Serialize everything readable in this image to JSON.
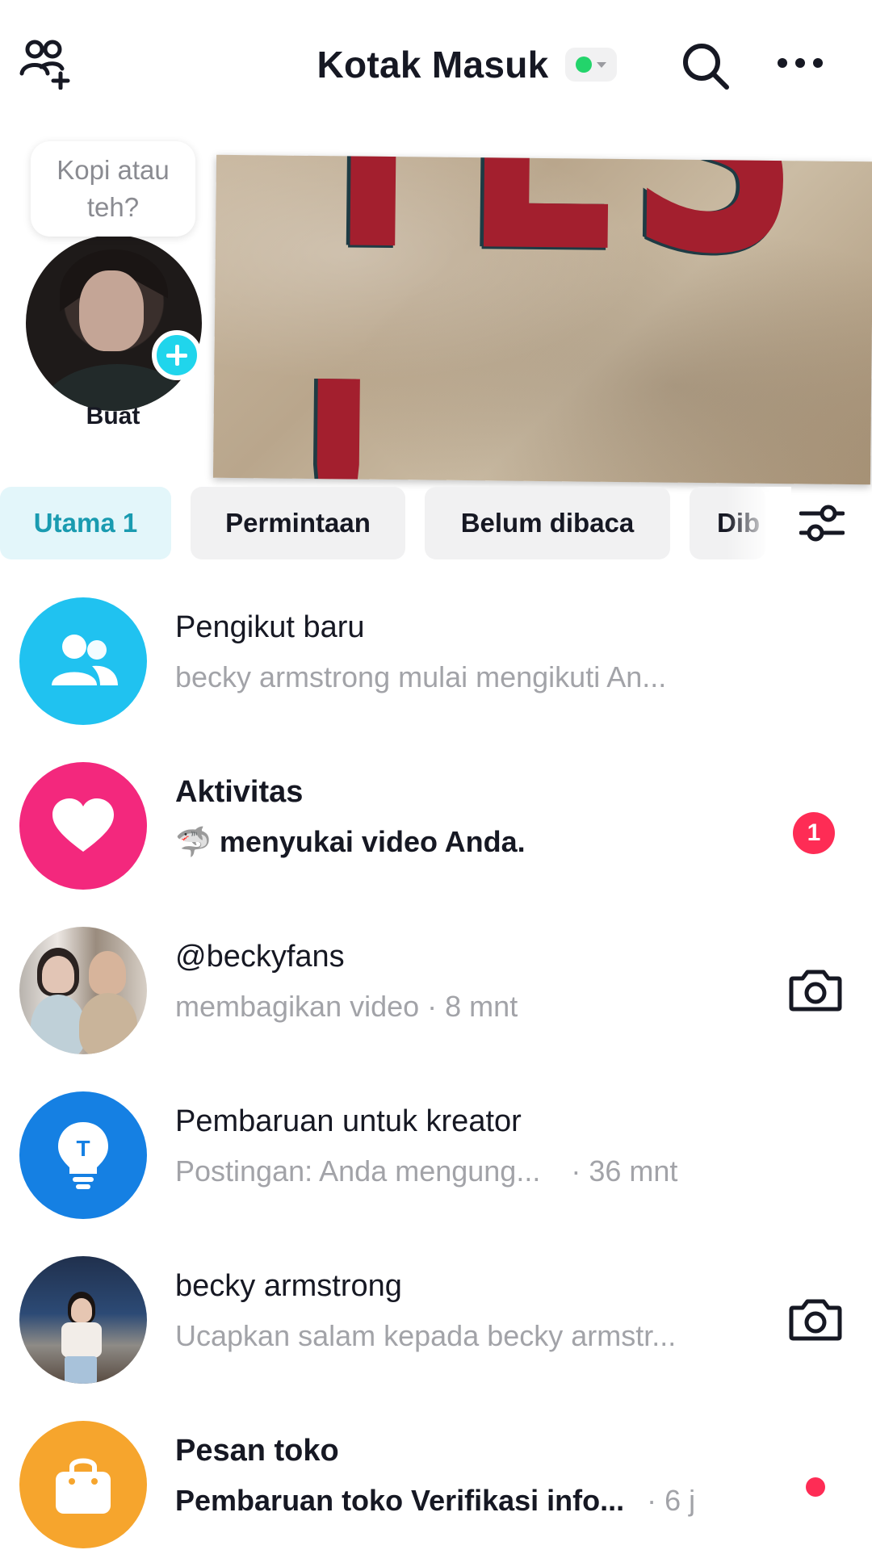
{
  "header": {
    "title": "Kotak Masuk",
    "status_color": "#23d46b",
    "icons": [
      "add-friends-icon",
      "search-icon",
      "more-icon"
    ]
  },
  "story": {
    "note": "Kopi atau teh?",
    "create_label": "Buat"
  },
  "banner": {
    "text": "YES !",
    "text_color": "#a31f2e"
  },
  "tabs": [
    {
      "label": "Utama 1",
      "active": true
    },
    {
      "label": "Permintaan",
      "active": false
    },
    {
      "label": "Belum dibaca",
      "active": false
    },
    {
      "label": "Dib",
      "active": false
    }
  ],
  "messages": [
    {
      "title": "Pengikut baru",
      "subtitle": "becky armstrong mulai mengikuti An...",
      "icon": "followers-icon",
      "color": "#20c2f0"
    },
    {
      "title": "Aktivitas",
      "subtitle_emoji": "🦈",
      "subtitle": "menyukai video Anda.",
      "badge": "1",
      "icon": "heart-icon",
      "color": "#f3287d"
    },
    {
      "title": "@beckyfans",
      "subtitle": "membagikan video · 8 mnt",
      "icon": "camera-icon"
    },
    {
      "title": "Pembaruan untuk kreator",
      "subtitle": "Postingan: Anda mengung...",
      "meta": "· 36 mnt",
      "icon": "lightbulb-icon",
      "color": "#1580e3"
    },
    {
      "title": "becky armstrong",
      "subtitle": "Ucapkan salam kepada becky armstr...",
      "icon": "camera-icon"
    },
    {
      "title": "Pesan toko",
      "subtitle": "Pembaruan toko Verifikasi info...",
      "meta": "· 6 j",
      "icon": "shopping-bag-icon",
      "color": "#f6a52d"
    }
  ]
}
